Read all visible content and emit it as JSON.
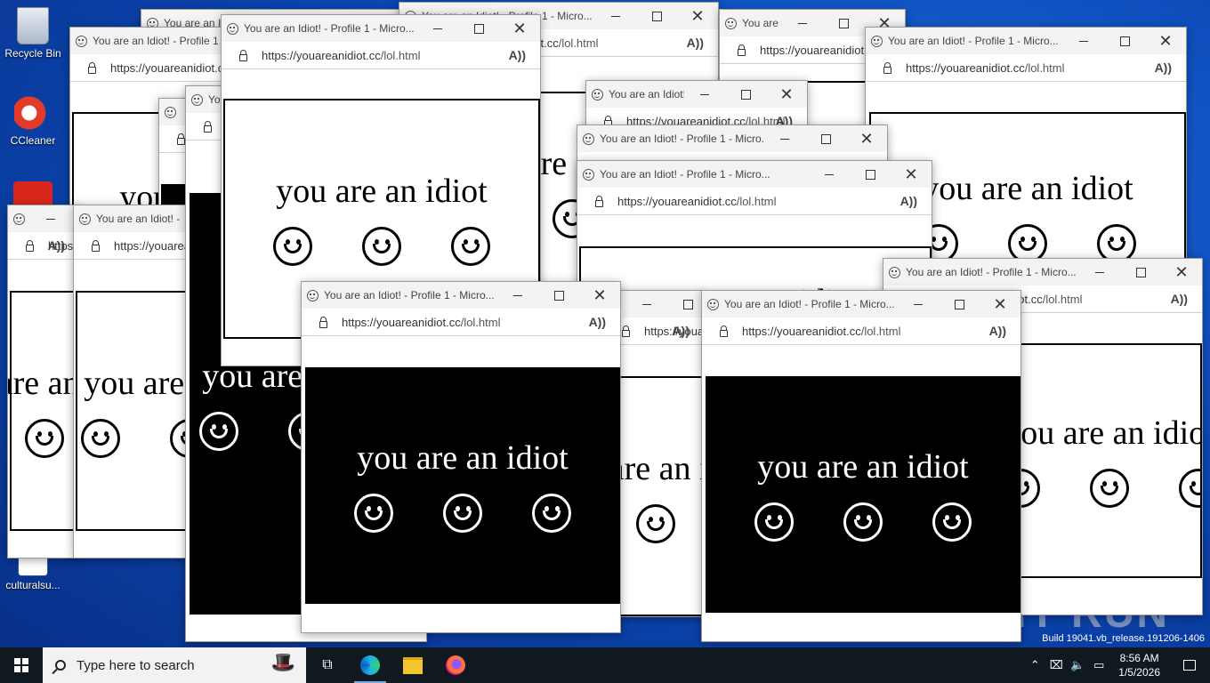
{
  "desktop": {
    "icons": [
      {
        "label": "Recycle Bin"
      },
      {
        "label": "CCleaner"
      },
      {
        "label": "culturalsu..."
      }
    ]
  },
  "popup": {
    "title": "You are an Idiot! - Profile 1 - Micro...",
    "url_host": "https://youareanidiot.cc",
    "url_path": "/lol.html",
    "message": "you are an idiot",
    "read_aloud": "Aͅ"
  },
  "windows": [
    {
      "title": "You are an Idiot! - Profile 1 - Micro...",
      "scheme": "light"
    },
    {
      "title": "You are an Idiot! - Profile 1 - Micro...",
      "scheme": "light"
    },
    {
      "title": "You are an Idiot! - Profile 1 - Micro...",
      "scheme": "dark"
    },
    {
      "title": "You are an Idiot! - Profile 1 - Micro...",
      "scheme": "light"
    },
    {
      "title": "You are an Idiot! - Profile 1 - Micro...",
      "scheme": "light"
    },
    {
      "title": "You are an Idiot! - Profile 1 - Micro...",
      "scheme": "light"
    },
    {
      "title": "You are an Idiot! - Profile 1 - Micro...",
      "scheme": "light"
    },
    {
      "title": "You are an Idiot! - Profile 1 - Micro...",
      "scheme": "light"
    },
    {
      "title": "You are an Idiot! - Profile 1 - Micro...",
      "scheme": "light"
    },
    {
      "title": "You are an Idiot! - Profile 1 - Micro...",
      "scheme": "dark"
    },
    {
      "title": "You are an Idiot! - Profile 1 - Micro...",
      "scheme": "dark"
    }
  ],
  "watermark": "ANY RUN",
  "build_text": "Build 19041.vb_release.191206-1406",
  "taskbar": {
    "search_placeholder": "Type here to search",
    "apps": [
      {
        "name": "task-view-icon",
        "active": false
      },
      {
        "name": "edge-icon",
        "active": true
      },
      {
        "name": "file-explorer-icon",
        "active": false
      },
      {
        "name": "firefox-icon",
        "active": false
      }
    ],
    "clock_time": "8:56 AM",
    "clock_date": "1/5/2026"
  },
  "colors": {
    "taskbar": "#101820",
    "desktop": "#0c49b8",
    "titlebar": "#f3f3f3"
  }
}
